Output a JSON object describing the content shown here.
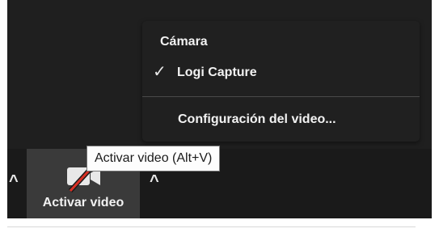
{
  "camera_menu": {
    "heading": "Cámara",
    "camera_item_label": "Logi Capture",
    "check_glyph": "✓",
    "settings_label": "Configuración del video..."
  },
  "toolbar": {
    "video_button_label": "Activar video",
    "video_icon": "video-off-icon",
    "caret_glyph": "^"
  },
  "tooltip": {
    "text": "Activar video (Alt+V)"
  },
  "colors": {
    "toolbar_bg": "#1a1a1a",
    "menu_bg": "#202020",
    "button_highlight": "#3a3a3a",
    "slash_red": "#d93025"
  }
}
